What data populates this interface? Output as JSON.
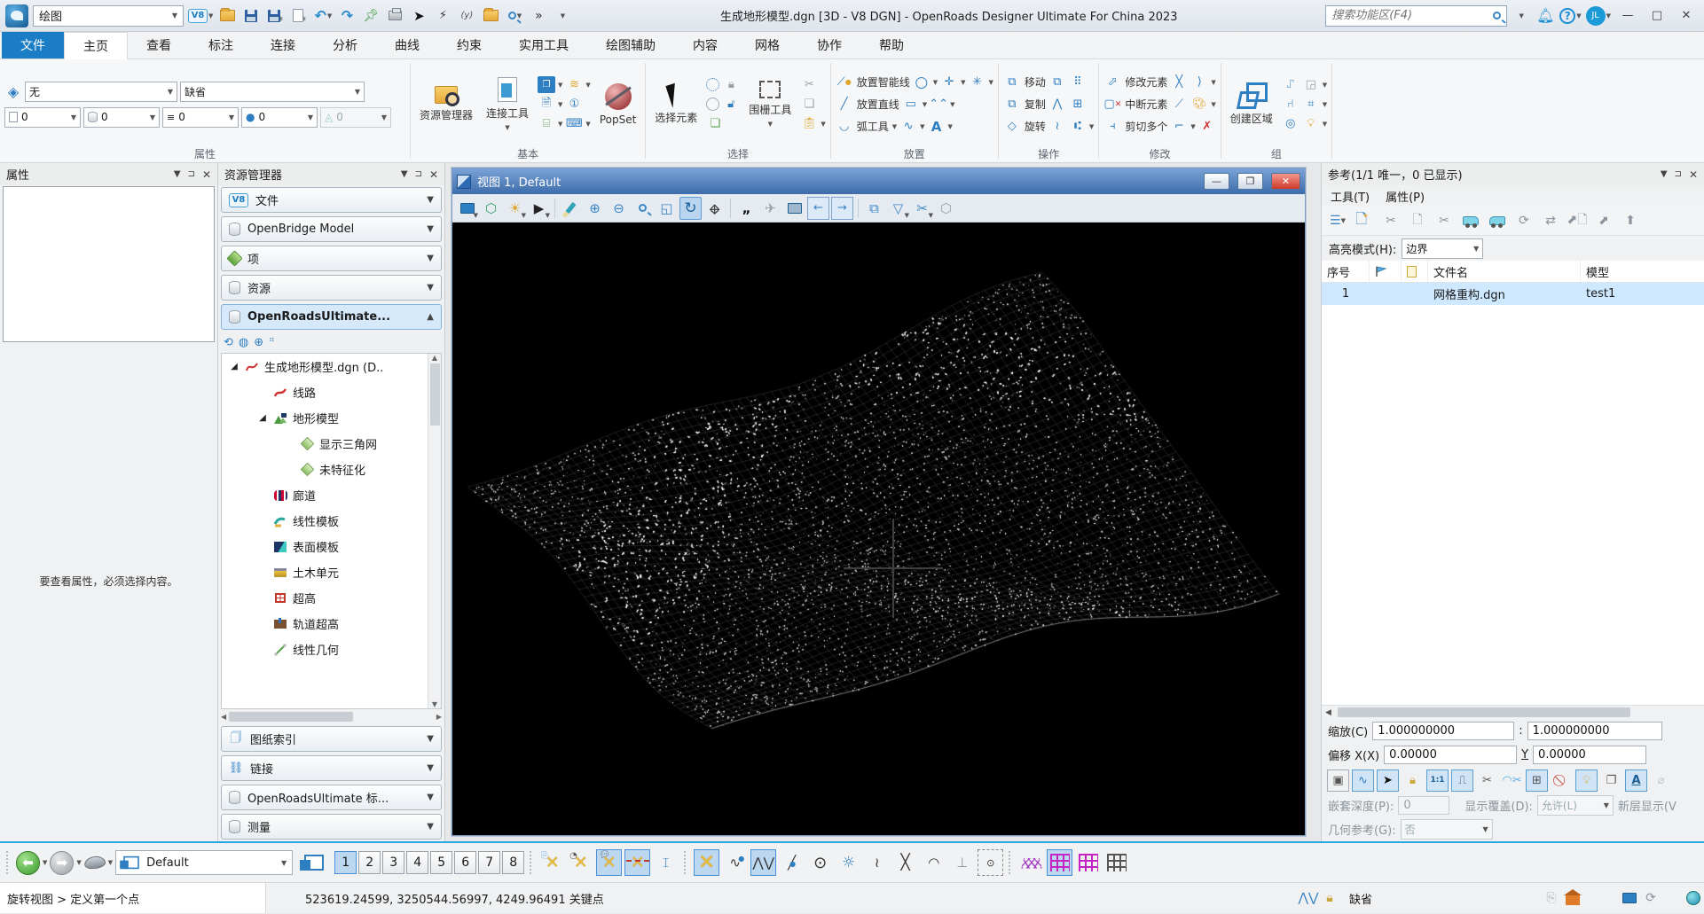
{
  "titlebar": {
    "workflow": "绘图",
    "version_badge": "V8",
    "title": "生成地形模型.dgn [3D - V8 DGN] - OpenRoads Designer Ultimate For China 2023",
    "search_placeholder": "搜索功能区(F4)",
    "avatar": "JL"
  },
  "tabs": {
    "items": [
      "文件",
      "主页",
      "查看",
      "标注",
      "连接",
      "分析",
      "曲线",
      "约束",
      "实用工具",
      "绘图辅助",
      "内容",
      "网格",
      "协作",
      "帮助"
    ],
    "active": "主页"
  },
  "ribbon": {
    "labels": [
      "属性",
      "基本",
      "选择",
      "放置",
      "操作",
      "修改",
      "组"
    ],
    "attr": {
      "style": "无",
      "template": "缺省",
      "v0": "0",
      "v1": "0",
      "v2": "0",
      "v3": "0",
      "v4": "0"
    },
    "basic": {
      "explorer": "资源管理器",
      "link": "连接工具",
      "popset": "PopSet"
    },
    "select": {
      "element": "选择元素",
      "fence": "围栅工具"
    },
    "place": {
      "smartline": "放置智能线",
      "line": "放置直线",
      "arc": "弧工具"
    },
    "manip": {
      "move": "移动",
      "copy": "复制",
      "rotate": "旋转"
    },
    "modify": {
      "edit": "修改元素",
      "break": "中断元素",
      "trim": "剪切多个"
    },
    "grp": {
      "region": "创建区域"
    }
  },
  "props": {
    "title": "属性",
    "hint": "要查看属性，必须选择内容。"
  },
  "explorer": {
    "title": "资源管理器",
    "sec0": "文件",
    "sec1": "OpenBridge Model",
    "sec2": "项",
    "sec3": "资源",
    "active": "OpenRoadsUltimate...",
    "t0": "生成地形模型.dgn (D..",
    "t1": "线路",
    "t2": "地形模型",
    "t3": "显示三角网",
    "t4": "未特征化",
    "t5": "廊道",
    "t6": "线性模板",
    "t7": "表面模板",
    "t8": "土木单元",
    "t9": "超高",
    "t10": "轨道超高",
    "t11": "线性几何",
    "b0": "图纸索引",
    "b1": "链接",
    "b2": "OpenRoadsUltimate 标...",
    "b3": "测量"
  },
  "viewport": {
    "title": "视图 1, Default"
  },
  "refs": {
    "title": "参考(1/1 唯一，0 已显示)",
    "menu_tools": "工具(T)",
    "menu_props": "属性(P)",
    "hl_label": "高亮模式(H):",
    "hl_value": "边界",
    "col_num": "序号",
    "col_file": "文件名",
    "col_model": "模型",
    "row_num": "1",
    "row_file": "网格重构.dgn",
    "row_model": "test1",
    "scale_label": "缩放(C)",
    "scale_a": "1.000000000",
    "scale_sep": ":",
    "scale_b": "1.000000000",
    "off_label": "偏移 X(X)",
    "off_x": "0.00000",
    "y_label": "Y",
    "off_y": "0.00000",
    "nest_label": "嵌套深度(P):",
    "nest_value": "0",
    "ovr_label": "显示覆盖(D):",
    "ovr_value": "允许(L)",
    "newlvl_label": "新层显示(V",
    "geo_label": "几何参考(G):",
    "geo_value": "否"
  },
  "bottombar": {
    "view_group": "Default",
    "n1": "1",
    "n2": "2",
    "n3": "3",
    "n4": "4",
    "n5": "5",
    "n6": "6",
    "n7": "7",
    "n8": "8"
  },
  "statusbar": {
    "prompt": "旋转视图 > 定义第一个点",
    "coords": "523619.24599, 3250544.56997, 4249.96491 关键点",
    "mode": "缺省"
  },
  "colors": {
    "accent": "#1a7dc5",
    "viewport_title": "#4478b8",
    "canvas": "#000000",
    "selection": "#cde8ff",
    "active_toggle": "#cfe4f6"
  }
}
